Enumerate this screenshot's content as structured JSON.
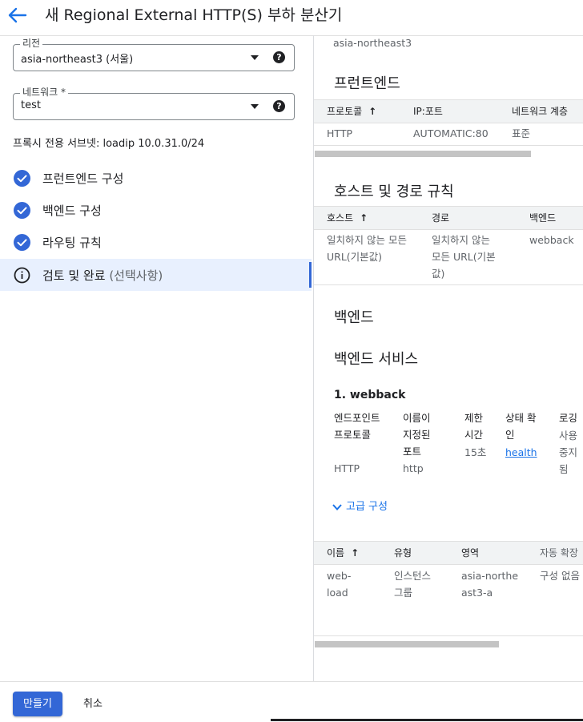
{
  "header": {
    "title": "새 Regional External HTTP(S) 부하 분산기"
  },
  "region": {
    "label": "리전",
    "value": "asia-northeast3 (서울)"
  },
  "network": {
    "label": "네트워크 *",
    "value": "test"
  },
  "proxy_subnet": "프록시 전용 서브넷: loadip 10.0.31.0/24",
  "steps": [
    {
      "label": "프런트엔드 구성",
      "status": "complete"
    },
    {
      "label": "백엔드 구성",
      "status": "complete"
    },
    {
      "label": "라우팅 규칙",
      "status": "complete"
    },
    {
      "label": "검토 및 완료",
      "optional": "(선택사항)",
      "status": "current"
    }
  ],
  "review": {
    "region_value": "asia-northeast3",
    "frontend": {
      "title": "프런트엔드",
      "columns": [
        "프로토콜",
        "IP:포트",
        "네트워크 계층"
      ],
      "rows": [
        [
          "HTTP",
          "AUTOMATIC:80",
          "표준"
        ]
      ]
    },
    "host_path": {
      "title": "호스트 및 경로 규칙",
      "columns": [
        "호스트",
        "경로",
        "백엔드"
      ],
      "rows": [
        [
          "일치하지 않는 모든 URL(기본값)",
          "일치하지 않는 모든 URL(기본값)",
          "webback"
        ]
      ]
    },
    "backend": {
      "title": "백엔드",
      "services_title": "백엔드 서비스",
      "service_name": "1. webback",
      "service_columns": [
        "엔드포인트 프로토콜",
        "이름이 지정된 포트",
        "제한 시간",
        "상태 확인",
        "로깅"
      ],
      "service_values": [
        "HTTP",
        "http",
        "15초",
        "health",
        "사용 중지됨"
      ],
      "advanced_label": "고급 구성",
      "group_columns": [
        "이름",
        "유형",
        "영역",
        "자동 확장"
      ],
      "group_rows": [
        [
          "web-load",
          "인스턴스 그룹",
          "asia-northeast3-a",
          "구성 없음"
        ]
      ]
    }
  },
  "actions": {
    "create": "만들기",
    "cancel": "취소"
  },
  "colors": {
    "accent": "#3367d6",
    "step_check": "#3367d6",
    "link": "#1a73e8",
    "active_step_bg": "#e8f0fe"
  },
  "icons": {
    "back": "arrow-left-icon",
    "step_done": "check-circle-icon",
    "step_current": "info-icon",
    "help": "help-icon",
    "expand": "chevron-down-icon"
  }
}
